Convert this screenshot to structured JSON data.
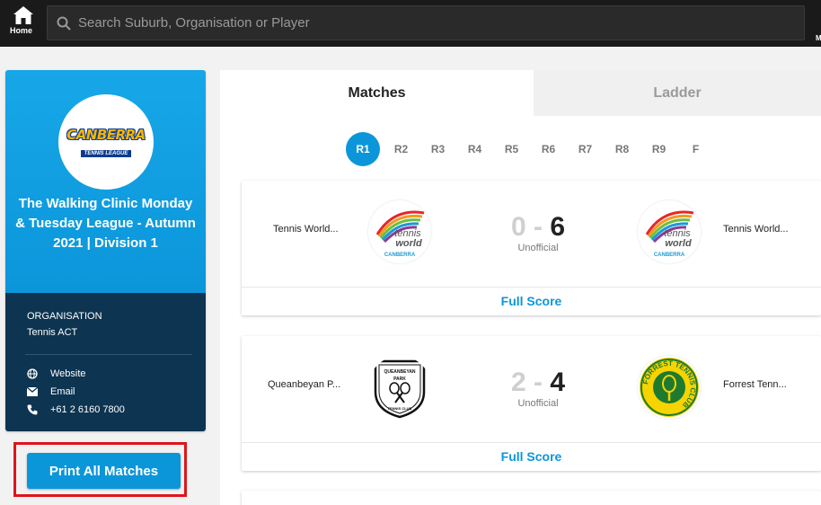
{
  "nav": {
    "home_label": "Home",
    "search_placeholder": "Search Suburb, Organisation or Player",
    "edge_letter": "M"
  },
  "sidebar": {
    "logo": {
      "main": "CANBERRA",
      "sub": "TENNIS LEAGUE"
    },
    "competition_name": "The Walking Clinic Monday & Tuesday League - Autumn 2021 | Division 1",
    "organisation_heading": "ORGANISATION",
    "organisation_name": "Tennis ACT",
    "links": {
      "website": "Website",
      "email": "Email",
      "phone": "+61 2 6160 7800"
    },
    "print_button": "Print All Matches"
  },
  "tabs": {
    "matches": "Matches",
    "ladder": "Ladder"
  },
  "rounds": [
    "R1",
    "R2",
    "R3",
    "R4",
    "R5",
    "R6",
    "R7",
    "R8",
    "R9",
    "F"
  ],
  "active_round": "R1",
  "matches": [
    {
      "home": {
        "name": "Tennis World...",
        "logo": "tennis-world-canberra-logo"
      },
      "away": {
        "name": "Tennis World...",
        "logo": "tennis-world-canberra-logo"
      },
      "home_score": "0",
      "away_score": "6",
      "status": "Unofficial",
      "full_score_label": "Full Score"
    },
    {
      "home": {
        "name": "Queanbeyan P...",
        "logo": "queanbeyan-park-tennis-club-logo"
      },
      "away": {
        "name": "Forrest Tenn...",
        "logo": "forrest-tennis-club-logo"
      },
      "home_score": "2",
      "away_score": "4",
      "status": "Unofficial",
      "full_score_label": "Full Score"
    }
  ],
  "logo_text": {
    "tennis_world": {
      "line1": "tennis",
      "line2": "world",
      "line3": "CANBERRA"
    },
    "queanbeyan": {
      "top": "QUEANBEYAN",
      "mid": "PARK",
      "bottom": "TENNIS CLUB"
    },
    "forrest": {
      "ring": "FORREST TENNIS CLUB"
    }
  },
  "colors": {
    "brand_blue": "#0b96da",
    "dark_navy": "#0d3450",
    "topbar": "#1a1a1a",
    "highlight_red": "#e0141b"
  }
}
